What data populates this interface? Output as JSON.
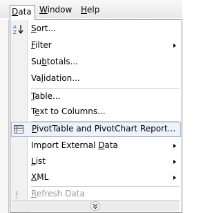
{
  "menubar": {
    "data_label": "Data",
    "window_label": "Window",
    "help_label": "Help"
  },
  "menu": {
    "items": [
      {
        "label": "Sort...",
        "icon": "sort-ascending-icon"
      },
      {
        "label": "Filter",
        "submenu": true
      },
      {
        "label": "Subtotals..."
      },
      {
        "label": "Validation..."
      },
      {
        "label": "Table..."
      },
      {
        "label": "Text to Columns..."
      },
      {
        "label": "PivotTable and PivotChart Report...",
        "icon": "pivot-table-icon",
        "highlighted": true
      },
      {
        "label": "Import External Data",
        "submenu": true
      },
      {
        "label": "List",
        "submenu": true
      },
      {
        "label": "XML",
        "submenu": true
      },
      {
        "label": "Refresh Data",
        "icon": "refresh-icon",
        "disabled": true
      }
    ]
  },
  "colors": {
    "highlight_bg": "#eef3fb",
    "highlight_border": "#aab7cf",
    "disabled_text": "#9a9a9a",
    "gutter": "#f1f1f1"
  }
}
